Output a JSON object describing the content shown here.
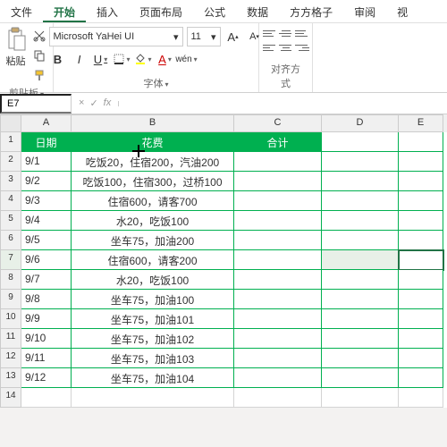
{
  "menu": {
    "file": "文件",
    "home": "开始",
    "insert": "插入",
    "layout": "页面布局",
    "formula": "公式",
    "data": "数据",
    "fanggezi": "方方格子",
    "review": "审阅",
    "view": "视"
  },
  "ribbon": {
    "clipboard": {
      "paste": "粘贴",
      "label": "剪贴板"
    },
    "font": {
      "name": "Microsoft YaHei UI",
      "size": "11",
      "bold": "B",
      "italic": "I",
      "underline": "U",
      "wen": "wén",
      "label": "字体"
    },
    "align": {
      "label": "对齐方式"
    }
  },
  "namebox": {
    "ref": "E7",
    "fx": "fx"
  },
  "headers": {
    "A": "A",
    "B": "B",
    "C": "C",
    "D": "D",
    "E": "E"
  },
  "table": {
    "head": {
      "date": "日期",
      "expense": "花费",
      "total": "合计"
    },
    "rows": [
      {
        "n": "2",
        "a": "9/1",
        "b": "吃饭20，住宿200，汽油200"
      },
      {
        "n": "3",
        "a": "9/2",
        "b": "吃饭100，住宿300，过桥100"
      },
      {
        "n": "4",
        "a": "9/3",
        "b": "住宿600，请客700"
      },
      {
        "n": "5",
        "a": "9/4",
        "b": "水20，吃饭100"
      },
      {
        "n": "6",
        "a": "9/5",
        "b": "坐车75，加油200"
      },
      {
        "n": "7",
        "a": "9/6",
        "b": "住宿600，请客200"
      },
      {
        "n": "8",
        "a": "9/7",
        "b": "水20，吃饭100"
      },
      {
        "n": "9",
        "a": "9/8",
        "b": "坐车75，加油100"
      },
      {
        "n": "10",
        "a": "9/9",
        "b": "坐车75，加油101"
      },
      {
        "n": "11",
        "a": "9/10",
        "b": "坐车75，加油102"
      },
      {
        "n": "12",
        "a": "9/11",
        "b": "坐车75，加油103"
      },
      {
        "n": "13",
        "a": "9/12",
        "b": "坐车75，加油104"
      },
      {
        "n": "14",
        "a": "",
        "b": ""
      }
    ]
  }
}
